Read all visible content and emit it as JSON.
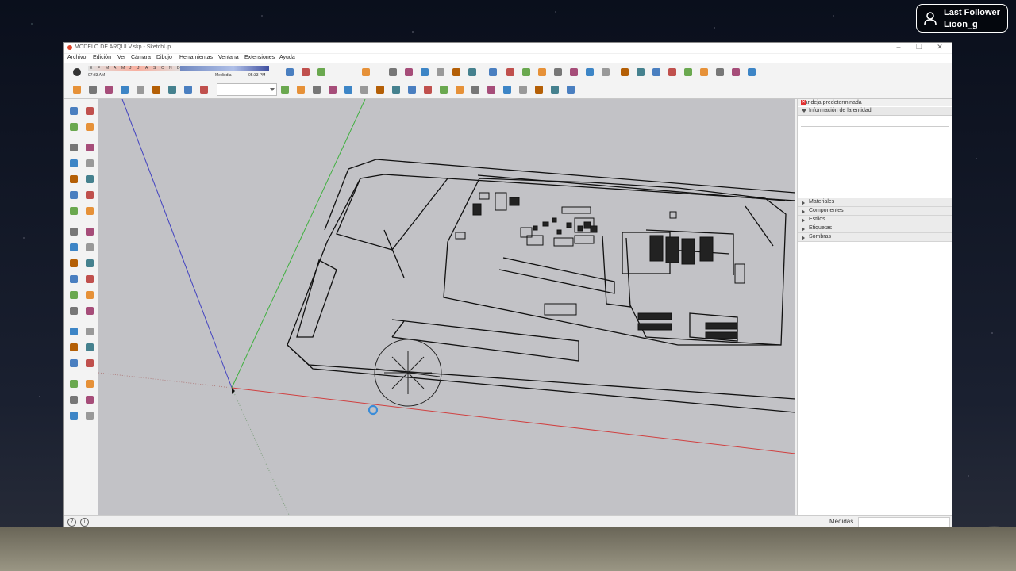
{
  "overlay": {
    "line1": "Last Follower",
    "line2": "Lioon_g"
  },
  "window": {
    "title": "MODELO DE ARQUI V.skp - SketchUp",
    "controls": {
      "minimize": "–",
      "restore": "❐",
      "close": "✕"
    }
  },
  "menu": [
    "Archivo",
    "Edición",
    "Ver",
    "Cámara",
    "Dibujo",
    "Herramientas",
    "Ventana",
    "Extensiones",
    "Ayuda"
  ],
  "shadow": {
    "months": [
      "E",
      "F",
      "M",
      "A",
      "M",
      "J",
      "J",
      "A",
      "S",
      "O",
      "N",
      "D"
    ],
    "time_start": "07:33 AM",
    "time_mid": "Mediodía",
    "time_end": "05:33 PM"
  },
  "tray": {
    "title": "Bandeja predeterminada",
    "pin": "⊞",
    "close": "✕",
    "entity_info": "Información de la entidad",
    "panels": [
      "Materiales",
      "Componentes",
      "Estilos",
      "Etiquetas",
      "Sombras"
    ]
  },
  "status": {
    "measurements_label": "Medidas",
    "info": "i",
    "help": "?"
  },
  "colors": {
    "axis_red": "#d04040",
    "axis_green": "#40b040",
    "axis_blue": "#4040c0",
    "viewport": "#c2c2c6",
    "tray_close": "#e03030"
  },
  "icons": {
    "toolbar1": [
      "eraser",
      "select",
      "paint",
      "move",
      "rotate",
      "push-pull",
      "offset",
      "warehouse",
      "component",
      "style-1",
      "style-2",
      "style-3",
      "style-4",
      "axes",
      "section",
      "top-view",
      "iso",
      "shadow",
      "fog",
      "sandbox-1",
      "sandbox-2",
      "sandbox-3",
      "sandbox-4",
      "sandbox-5",
      "sandbox-6",
      "sandbox-7",
      "sandbox-8"
    ],
    "toolbar2": [
      "move",
      "paint",
      "zoom",
      "zoom-extents",
      "zoom-window",
      "position-camera",
      "look-around",
      "walk",
      "layer-box",
      "solid-1",
      "solid-2",
      "solid-3",
      "solid-4",
      "solid-5",
      "solid-6",
      "solid-7",
      "solid-8",
      "view-1",
      "view-2",
      "view-3",
      "view-4",
      "view-5",
      "view-6",
      "view-7",
      "house-1",
      "house-2",
      "house-3",
      "house-4"
    ],
    "left": [
      "select",
      "component",
      "paint",
      "eraser",
      "line",
      "freehand",
      "rectangle",
      "rotated-rectangle",
      "circle",
      "polygon",
      "arc",
      "pie",
      "arc-2",
      "arc-3",
      "move",
      "push-pull",
      "rotate",
      "follow-me",
      "scale",
      "offset",
      "tape-measure",
      "dimension",
      "protractor",
      "text",
      "axes",
      "3d-text",
      "orbit",
      "pan",
      "zoom",
      "zoom-window",
      "zoom-extents",
      "previous",
      "position-camera",
      "look-around",
      "walk",
      "section-plane",
      "display-section",
      "section-cut"
    ]
  }
}
